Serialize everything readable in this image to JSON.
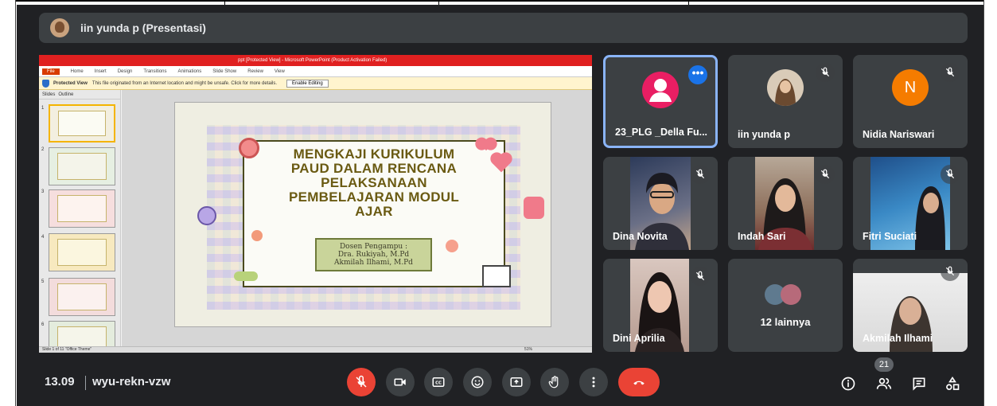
{
  "presenter": {
    "name": "iin yunda p (Presentasi)"
  },
  "powerpoint": {
    "title": "ppt [Protected View] - Microsoft PowerPoint (Product Activation Failed)",
    "ribbon_tabs": [
      "File",
      "Home",
      "Insert",
      "Design",
      "Transitions",
      "Animations",
      "Slide Show",
      "Review",
      "View"
    ],
    "protected_label": "Protected View",
    "protected_msg": "This file originated from an Internet location and might be unsafe. Click for more details.",
    "enable_editing": "Enable Editing",
    "panel_tabs": [
      "Slides",
      "Outline"
    ],
    "thumb_numbers": [
      "1",
      "2",
      "3",
      "4",
      "5",
      "6"
    ],
    "status": "Slide 1 of 11   \"Office Theme\"",
    "zoom": "51%"
  },
  "slide": {
    "title_lines": [
      "MENGKAJI KURIKULUM",
      "PAUD DALAM RENCANA",
      "PELAKSANAAN",
      "PEMBELAJARAN MODUL",
      "AJAR"
    ],
    "dosen_label": "Dosen Pengampu :",
    "dosen_1": "Dra. Rukiyah, M.Pd",
    "dosen_2": "Akmilah Ilhami, M.Pd"
  },
  "participants": [
    {
      "name": "23_PLG _Della Fu...",
      "type": "avatar-default",
      "color": "#e91e63"
    },
    {
      "name": "iin yunda p",
      "type": "avatar-photo"
    },
    {
      "name": "Nidia Nariswari",
      "type": "avatar-letter",
      "letter": "N",
      "color": "#f57c00"
    },
    {
      "name": "Dina Novita",
      "type": "video"
    },
    {
      "name": "Indah Sari",
      "type": "video"
    },
    {
      "name": "Fitri Suciati",
      "type": "video"
    },
    {
      "name": "Dini Aprilia",
      "type": "video"
    },
    {
      "name": "12 lainnya",
      "type": "others"
    },
    {
      "name": "Akmilah Ilhami",
      "type": "video"
    }
  ],
  "bottom": {
    "time": "13.09",
    "code": "wyu-rekn-vzw",
    "people_count": "21"
  },
  "colors": {
    "bg": "#202124",
    "tile": "#3c4043",
    "red": "#ea4335",
    "blue": "#1a73e8",
    "active_border": "#8ab4f8"
  }
}
